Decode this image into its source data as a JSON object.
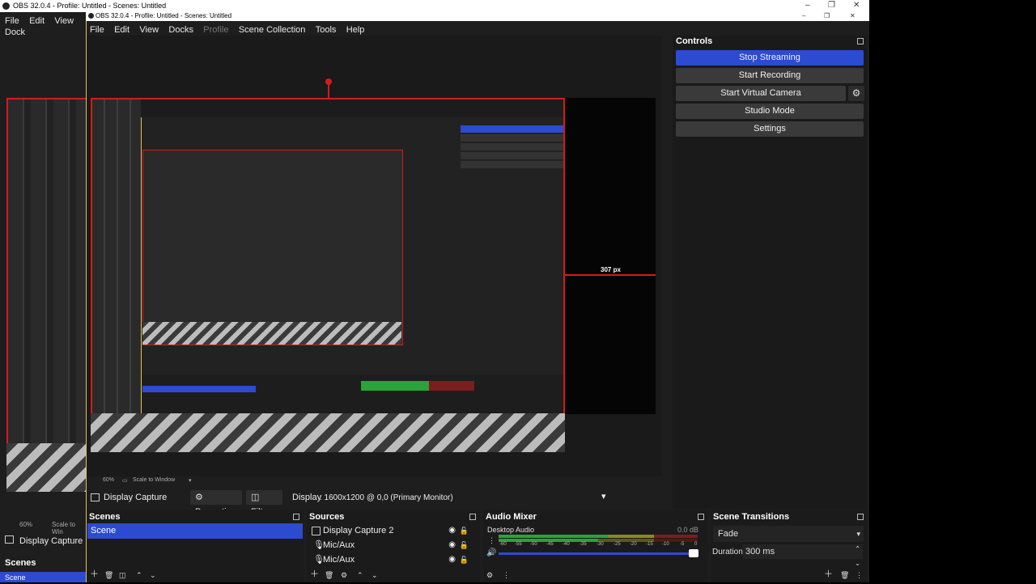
{
  "background_window": {
    "title": "OBS 32.0.4 - Profile: Untitled - Scenes: Untitled",
    "menu": [
      "File",
      "Edit",
      "View",
      "Dock"
    ],
    "zoom": "60%",
    "scale": "Scale to Win",
    "source_label": "Display Capture",
    "scenes_header": "Scenes",
    "scene_item": "Scene"
  },
  "window": {
    "title": "OBS 32.0.4 - Profile: Untitled - Scenes: Untitled",
    "menu": [
      "File",
      "Edit",
      "View",
      "Docks",
      "Profile",
      "Scene Collection",
      "Tools",
      "Help"
    ]
  },
  "preview": {
    "measure_label": "307 px",
    "zoom": "60%",
    "scale": "Scale to Window"
  },
  "controls": {
    "header": "Controls",
    "stop_streaming": "Stop Streaming",
    "start_recording": "Start Recording",
    "start_virtual_camera": "Start Virtual Camera",
    "studio_mode": "Studio Mode",
    "settings": "Settings"
  },
  "source_toolbar": {
    "source_name": "Display Capture",
    "properties": "Properties",
    "filters": "Filters",
    "display_label": "Display",
    "display_value": ": 1600x1200 @ 0,0 (Primary Monitor)"
  },
  "scenes": {
    "header": "Scenes",
    "items": [
      "Scene"
    ]
  },
  "sources": {
    "header": "Sources",
    "items": [
      "Display Capture 2",
      "Mic/Aux",
      "Mic/Aux"
    ]
  },
  "mixer": {
    "header": "Audio Mixer",
    "track": "Desktop Audio",
    "db": "0.0 dB",
    "ticks": [
      "-60",
      "-55",
      "-50",
      "-45",
      "-40",
      "-35",
      "-30",
      "-25",
      "-20",
      "-15",
      "-10",
      "-5",
      "0"
    ]
  },
  "transitions": {
    "header": "Scene Transitions",
    "selected": "Fade",
    "duration_label": "Duration",
    "duration_value": "300 ms"
  },
  "colors": {
    "accent": "#2c4bd1",
    "selection_border": "#d61a1a",
    "window_border": "#e5c454"
  }
}
